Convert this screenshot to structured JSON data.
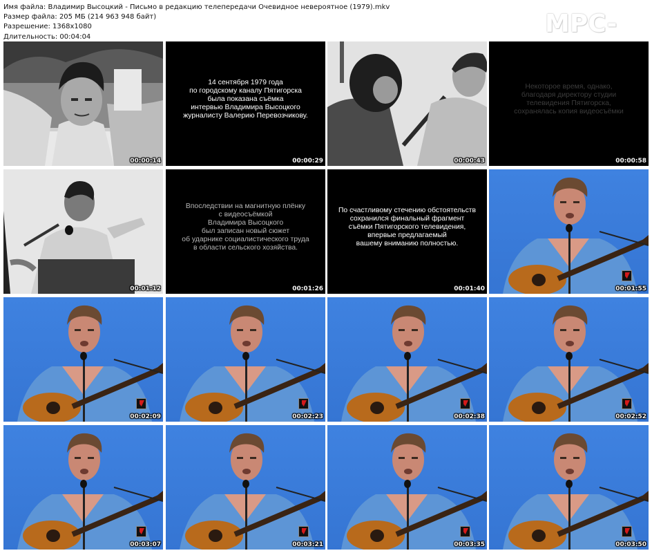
{
  "file_info": {
    "filename_line": "Имя файла: Владимир Высоцкий - Письмо в редакцию телепередачи Очевидное невероятное (1979).mkv",
    "size_line": "Размер файла: 205 МБ (214 963 948 байт)",
    "resolution_line": "Разрешение: 1368x1080",
    "duration_line": "Длительность: 00:04:04"
  },
  "logo_text": "MPC-HC",
  "thumbnails": [
    {
      "time": "00:00:14",
      "kind": "photo-bw-portrait"
    },
    {
      "time": "00:00:29",
      "kind": "caption",
      "text": "14 сентября 1979 года\nпо городскому каналу Пятигорска\nбыла показана съёмка\nинтервью Владимира Высоцкого\nжурналисту Валерию Перевозчикову."
    },
    {
      "time": "00:00:43",
      "kind": "photo-bw-interview"
    },
    {
      "time": "00:00:58",
      "kind": "caption-dim",
      "text": "Некоторое время, однако,\nблагодаря директору студии\nтелевидения Пятигорска,\nсохранялась копия видеосъёмки"
    },
    {
      "time": "00:01:12",
      "kind": "photo-bw-gesture"
    },
    {
      "time": "00:01:26",
      "kind": "caption-mid",
      "text": "Впоследствии на магнитную плёнку\nс видеосъёмкой\nВладимира Высоцкого\nбыл записан новый сюжет\nоб ударнике социалистического труда\nв области сельского хозяйства."
    },
    {
      "time": "00:01:40",
      "kind": "caption",
      "text": "По счастливому стечению обстоятельств\nсохранился финальный фрагмент\nсъёмки Пятигорского телевидения,\nвпервые  предлагаемый\nвашему вниманию полностью."
    },
    {
      "time": "00:01:55",
      "kind": "color-performance"
    },
    {
      "time": "00:02:09",
      "kind": "color-performance"
    },
    {
      "time": "00:02:23",
      "kind": "color-performance"
    },
    {
      "time": "00:02:38",
      "kind": "color-performance"
    },
    {
      "time": "00:02:52",
      "kind": "color-performance"
    },
    {
      "time": "00:03:07",
      "kind": "color-performance"
    },
    {
      "time": "00:03:21",
      "kind": "color-performance"
    },
    {
      "time": "00:03:35",
      "kind": "color-performance"
    },
    {
      "time": "00:03:50",
      "kind": "color-performance"
    }
  ]
}
